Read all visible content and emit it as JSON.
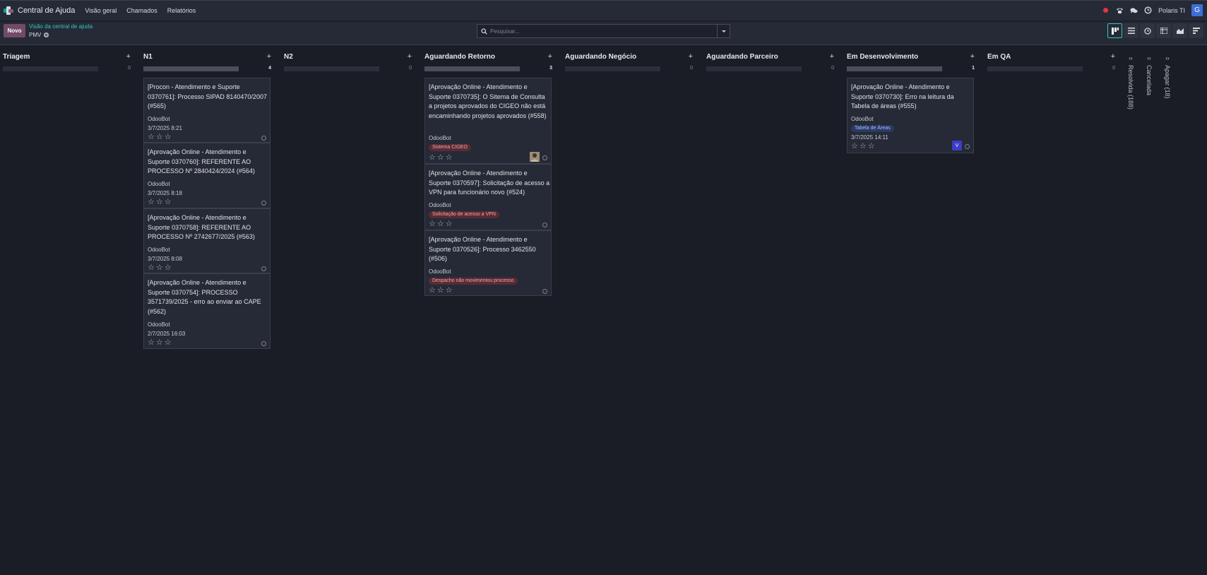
{
  "app": {
    "title": "Central de Ajuda",
    "menu": [
      "Visão geral",
      "Chamados",
      "Relatórios"
    ],
    "company": "Polaris TI",
    "user_initial": "G"
  },
  "control_panel": {
    "new_label": "Novo",
    "breadcrumb_parent": "Visão da central de ajuda",
    "breadcrumb_current": "PMV",
    "search_placeholder": "Pesquisar..."
  },
  "columns": [
    {
      "title": "Triagem",
      "count": "0"
    },
    {
      "title": "N1",
      "count": "4"
    },
    {
      "title": "N2",
      "count": "0"
    },
    {
      "title": "Aguardando Retorno",
      "count": "3"
    },
    {
      "title": "Aguardando Negócio",
      "count": "0"
    },
    {
      "title": "Aguardando Parceiro",
      "count": "0"
    },
    {
      "title": "Em Desenvolvimento",
      "count": "1"
    },
    {
      "title": "Em QA",
      "count": "0"
    }
  ],
  "folded_columns": [
    "Resolvida (188)",
    "Cancelada",
    "Apagar (18)"
  ],
  "cards": {
    "n1": [
      {
        "title": "[Procon - Atendimento e Suporte 0370761]: Processo SIPAD 8140470/2007 (#565)",
        "author": "OdooBot",
        "date": "3/7/2025 8:21"
      },
      {
        "title": "[Aprovação Online - Atendimento e Suporte 0370760]: REFERENTE AO PROCESSO Nº 2840424/2024 (#564)",
        "author": "OdooBot",
        "date": "3/7/2025 8:18"
      },
      {
        "title": "[Aprovação Online - Atendimento e Suporte 0370758]: REFERENTE AO PROCESSO Nº 2742677/2025 (#563)",
        "author": "OdooBot",
        "date": "3/7/2025 8:08"
      },
      {
        "title": "[Aprovação Online - Atendimento e Suporte 0370754]: PROCESSO 3571739/2025 - erro ao enviar ao CAPE (#562)",
        "author": "OdooBot",
        "date": "2/7/2025 16:03"
      }
    ],
    "retorno": [
      {
        "title": "[Aprovação Online - Atendimento e Suporte 0370735]: O Sitema de Consulta a projetos aprovados do CIGEO não está encaminhando projetos aprovados (#558)",
        "author": "OdooBot",
        "tag": "Sistema CIGEO"
      },
      {
        "title": "[Aprovação Online - Atendimento e Suporte 0370597]: Solicitação de acesso a VPN para funcionário novo (#524)",
        "author": "OdooBot",
        "tag": "Solicitação de acesso a VPN"
      },
      {
        "title": "[Aprovação Online - Atendimento e Suporte 0370526]: Processo 3462550 (#506)",
        "author": "OdooBot",
        "tag": "Despacho não movimentou processo"
      }
    ],
    "dev": [
      {
        "title": "[Aprovação Online - Atendimento e Suporte 0370730]: Erro na leitura da Tabela de áreas (#555)",
        "author": "OdooBot",
        "tag": "Tabela de Áreas",
        "date": "3/7/2025 14:11",
        "assignee": "V"
      }
    ]
  },
  "colors": {
    "accent": "#2ec7bd",
    "primary": "#714b67",
    "tag_red": "#5a2b33",
    "tag_blue": "#293a66",
    "avatar": "#3d6fd6"
  }
}
